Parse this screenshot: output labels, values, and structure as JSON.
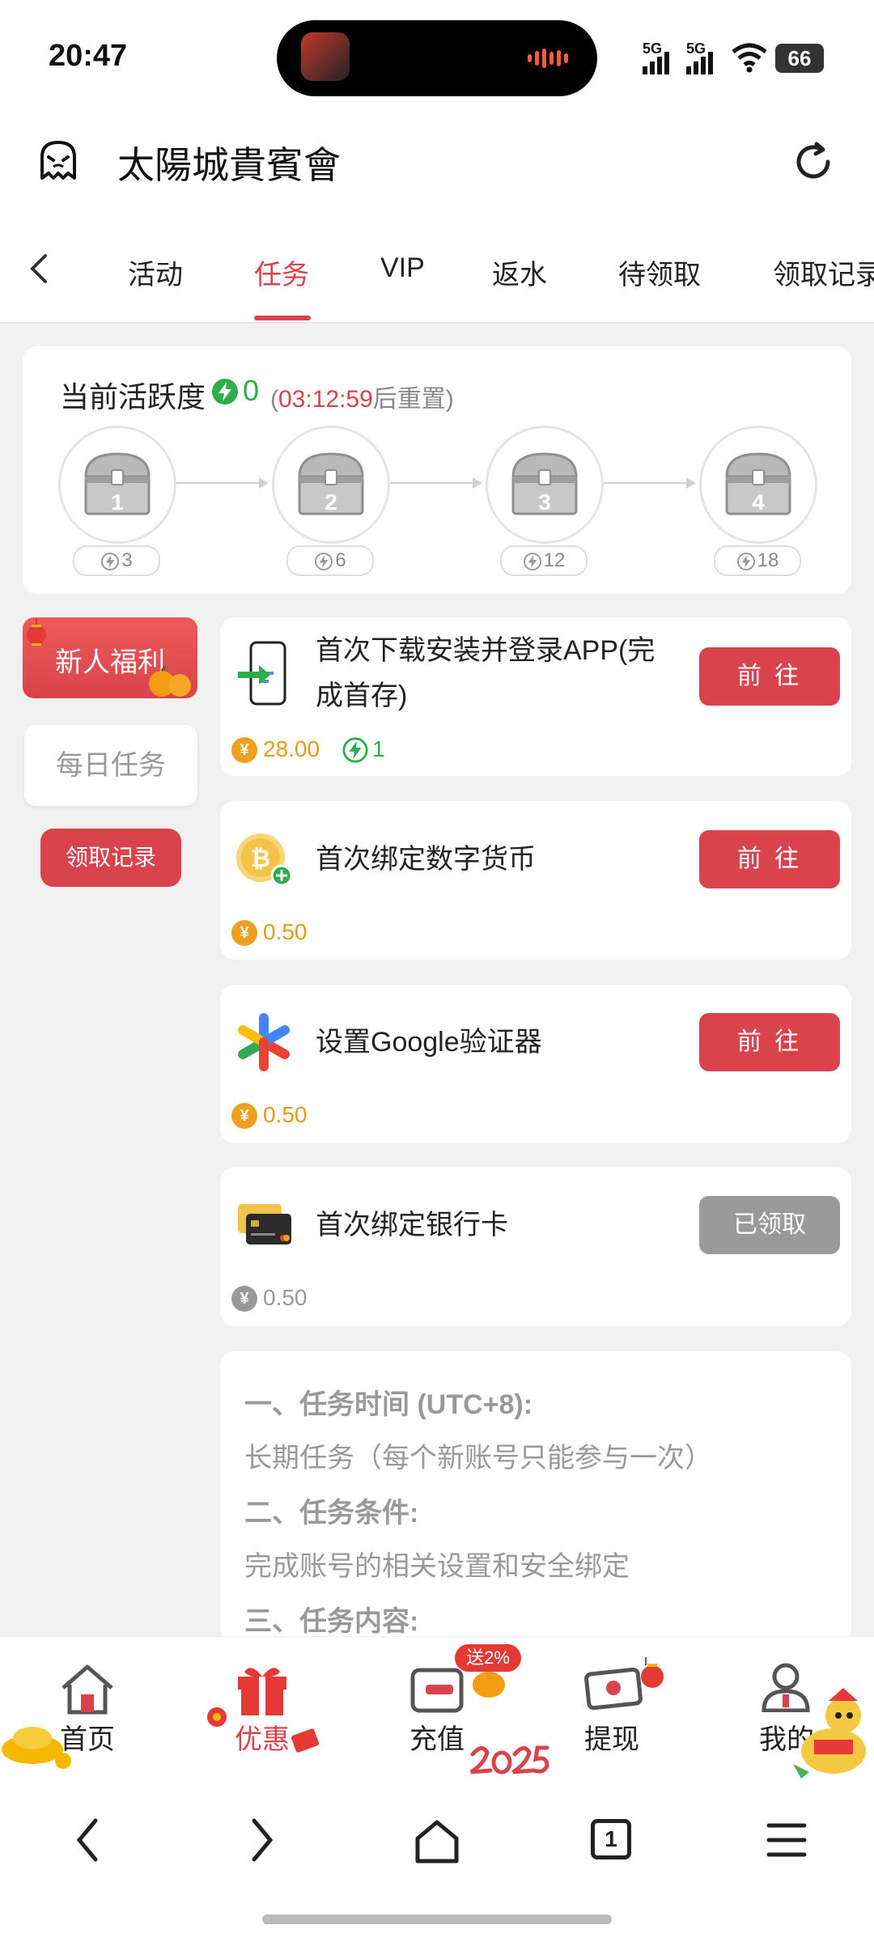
{
  "status": {
    "time": "20:47",
    "sig1": "5G",
    "sig2": "5G",
    "battery": "66"
  },
  "header": {
    "title": "太陽城貴賓會"
  },
  "tabs": [
    {
      "label": "活动"
    },
    {
      "label": "任务"
    },
    {
      "label": "VIP"
    },
    {
      "label": "返水"
    },
    {
      "label": "待领取"
    },
    {
      "label": "领取记录"
    }
  ],
  "activity": {
    "label": "当前活跃度",
    "value": "0",
    "reset_open": "(",
    "reset_time": "03:12:59",
    "reset_text": "后重置)",
    "chests": [
      {
        "num": "1",
        "cost": "3"
      },
      {
        "num": "2",
        "cost": "6"
      },
      {
        "num": "3",
        "cost": "12"
      },
      {
        "num": "4",
        "cost": "18"
      }
    ]
  },
  "sidebar": {
    "newbie": "新人福利",
    "daily": "每日任务",
    "record": "领取记录"
  },
  "tasks": [
    {
      "title": "首次下载安装并登录APP(完成首存)",
      "button": "前 往",
      "reward": "28.00",
      "activity": "1"
    },
    {
      "title": "首次绑定数字货币",
      "button": "前 往",
      "reward": "0.50"
    },
    {
      "title": "设置Google验证器",
      "button": "前 往",
      "reward": "0.50"
    },
    {
      "title": "首次绑定银行卡",
      "button": "已领取",
      "reward": "0.50"
    }
  ],
  "rules": {
    "h1": "一、任务时间 (UTC+8):",
    "t1": "长期任务（每个新账号只能参与一次）",
    "h2": "二、任务条件:",
    "t2": "完成账号的相关设置和安全绑定",
    "h3": "三、任务内容:"
  },
  "nav": {
    "home": "首页",
    "promo": "优惠",
    "deposit": "充值",
    "deposit_badge": "送2%",
    "withdraw": "提现",
    "mine": "我的"
  },
  "browser": {
    "tabs_count": "1"
  },
  "colors": {
    "accent": "#d9434b",
    "green": "#2eae4a",
    "gold": "#f0a020",
    "gray_button": "#9a9a9a"
  }
}
